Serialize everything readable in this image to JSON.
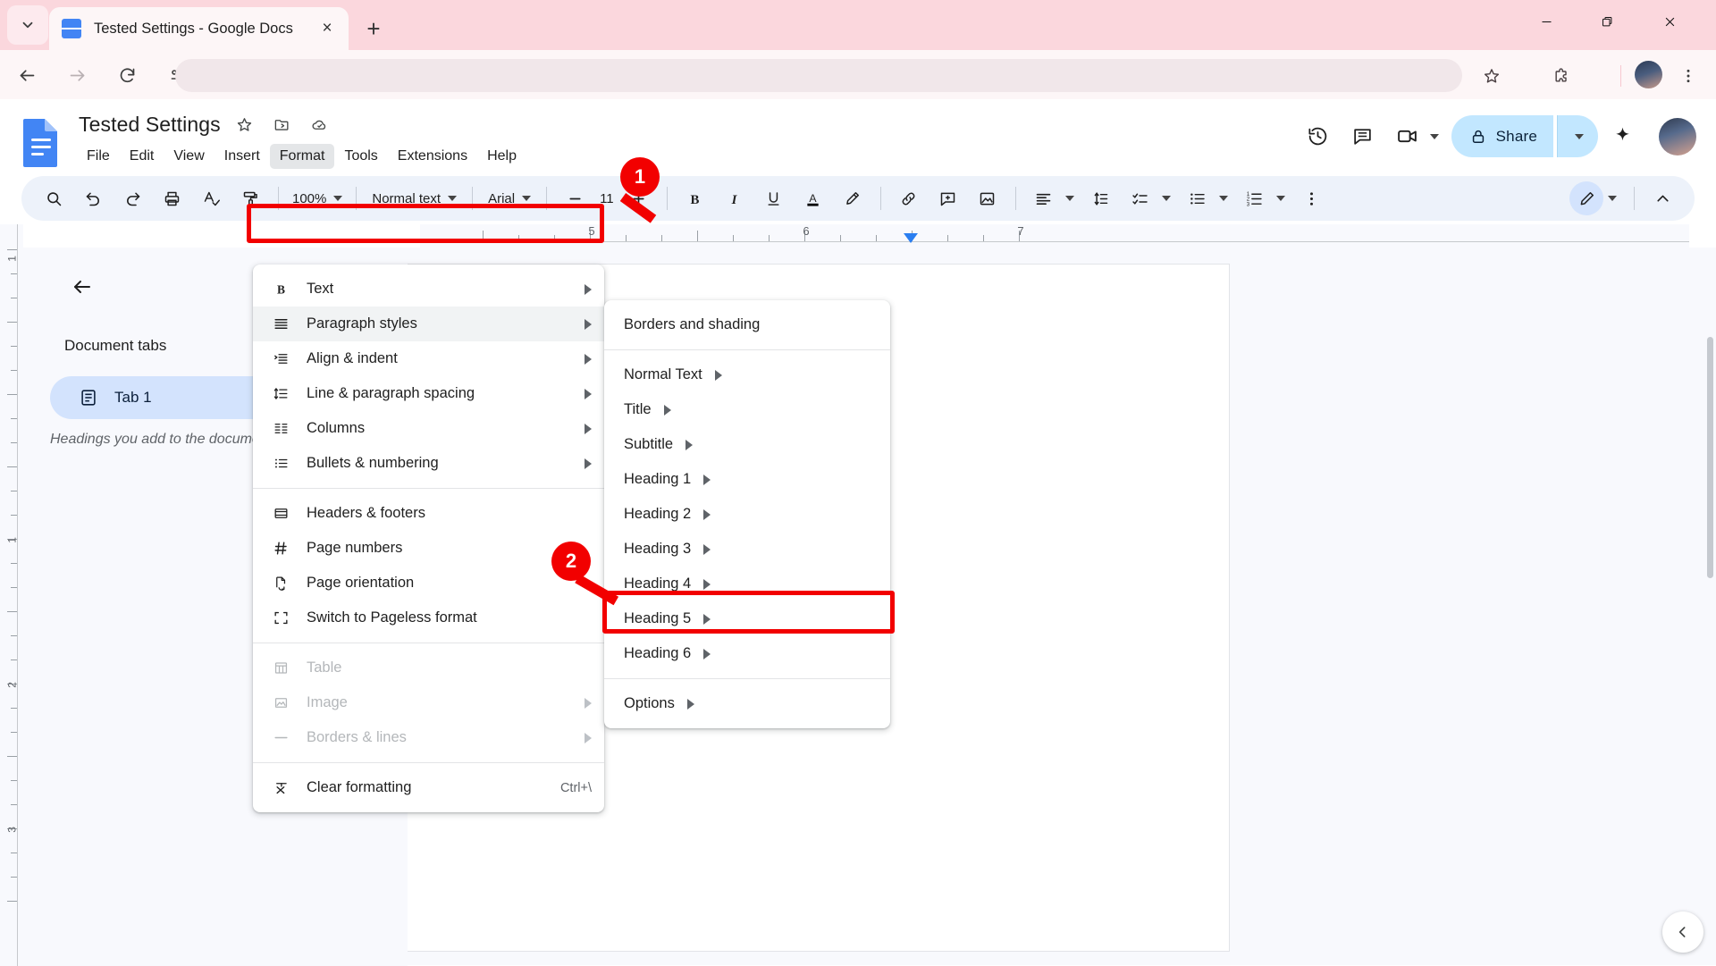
{
  "browser": {
    "tab": {
      "title": "Tested Settings - Google Docs",
      "favicon": "docs-icon",
      "close": "×"
    },
    "new_tab": "+",
    "window_controls": {
      "minimize": "minimize-icon",
      "maximize": "maximize-icon",
      "close": "close-icon"
    },
    "omnibox": {
      "value": "",
      "placeholder": ""
    },
    "toolbar_icons": [
      "back-icon",
      "forward-icon",
      "reload-icon",
      "site-settings-icon",
      "bookmark-star-icon",
      "extensions-icon",
      "profile-avatar",
      "chrome-menu-icon"
    ]
  },
  "docs": {
    "title": "Tested Settings",
    "title_icons": [
      "star-icon",
      "move-to-folder-icon",
      "cloud-saved-icon"
    ],
    "menus": [
      "File",
      "Edit",
      "View",
      "Insert",
      "Format",
      "Tools",
      "Extensions",
      "Help"
    ],
    "active_menu": "Format",
    "header_right": {
      "history_label": "version-history-icon",
      "comments_label": "comments-icon",
      "meet_label": "meet-icon",
      "share_label": "Share",
      "gemini_label": "gemini-spark-icon",
      "avatar_label": "account-avatar"
    },
    "toolbar": {
      "zoom": "100%",
      "style": "Normal text",
      "font": "Arial",
      "font_size": "11",
      "items": [
        "search-icon",
        "undo-icon",
        "redo-icon",
        "print-icon",
        "spellcheck-icon",
        "paint-format-icon",
        "decrease-font-icon",
        "increase-font-icon",
        "bold-icon",
        "italic-icon",
        "underline-icon",
        "text-color-icon",
        "highlight-color-icon",
        "link-icon",
        "comment-icon",
        "image-icon",
        "align-icon",
        "line-spacing-icon",
        "checklist-icon",
        "bulleted-list-icon",
        "numbered-list-icon",
        "more-options-icon",
        "editing-mode-icon",
        "hide-menus-icon"
      ]
    },
    "ruler": {
      "horizontal_numbers": [
        "5",
        "6",
        "7"
      ],
      "vertical_numbers": [
        "1",
        "1",
        "2",
        "3"
      ],
      "indent_marker": "right-indent-marker"
    },
    "outline": {
      "back": "back-arrow-icon",
      "heading": "Document tabs",
      "tab_label": "Tab 1",
      "tab_icon": "document-tab-icon",
      "hint": "Headings you add to the document will appear here."
    },
    "collapse_button": "collapse-panel-icon"
  },
  "format_menu": {
    "items": [
      {
        "label": "Text",
        "icon": "bold-B-icon",
        "arrow": true,
        "disabled": false,
        "highlight": false,
        "shortcut": ""
      },
      {
        "label": "Paragraph styles",
        "icon": "paragraph-styles-icon",
        "arrow": true,
        "disabled": false,
        "highlight": true,
        "shortcut": ""
      },
      {
        "label": "Align & indent",
        "icon": "align-indent-icon",
        "arrow": true,
        "disabled": false,
        "highlight": false,
        "shortcut": ""
      },
      {
        "label": "Line & paragraph spacing",
        "icon": "line-spacing-icon",
        "arrow": true,
        "disabled": false,
        "highlight": false,
        "shortcut": ""
      },
      {
        "label": "Columns",
        "icon": "columns-icon",
        "arrow": true,
        "disabled": false,
        "highlight": false,
        "shortcut": ""
      },
      {
        "label": "Bullets & numbering",
        "icon": "bullets-numbering-icon",
        "arrow": true,
        "disabled": false,
        "highlight": false,
        "shortcut": ""
      },
      {
        "separator": true
      },
      {
        "label": "Headers & footers",
        "icon": "headers-footers-icon",
        "arrow": false,
        "disabled": false,
        "highlight": false,
        "shortcut": ""
      },
      {
        "label": "Page numbers",
        "icon": "page-numbers-icon",
        "arrow": false,
        "disabled": false,
        "highlight": false,
        "shortcut": ""
      },
      {
        "label": "Page orientation",
        "icon": "page-orientation-icon",
        "arrow": false,
        "disabled": false,
        "highlight": false,
        "shortcut": ""
      },
      {
        "label": "Switch to Pageless format",
        "icon": "pageless-icon",
        "arrow": false,
        "disabled": false,
        "highlight": false,
        "shortcut": ""
      },
      {
        "separator": true
      },
      {
        "label": "Table",
        "icon": "table-icon",
        "arrow": false,
        "disabled": true,
        "highlight": false,
        "shortcut": ""
      },
      {
        "label": "Image",
        "icon": "image-icon",
        "arrow": true,
        "disabled": true,
        "highlight": false,
        "shortcut": ""
      },
      {
        "label": "Borders & lines",
        "icon": "borders-lines-icon",
        "arrow": true,
        "disabled": true,
        "highlight": false,
        "shortcut": ""
      },
      {
        "separator": true
      },
      {
        "label": "Clear formatting",
        "icon": "clear-formatting-icon",
        "arrow": false,
        "disabled": false,
        "highlight": false,
        "shortcut": "Ctrl+\\"
      }
    ]
  },
  "paragraph_styles_submenu": {
    "items": [
      {
        "label": "Borders and shading",
        "arrow": false,
        "highlight": false
      },
      {
        "separator": true
      },
      {
        "label": "Normal Text",
        "arrow": true,
        "highlight": false
      },
      {
        "label": "Title",
        "arrow": true,
        "highlight": false
      },
      {
        "label": "Subtitle",
        "arrow": true,
        "highlight": false
      },
      {
        "label": "Heading 1",
        "arrow": true,
        "highlight": false
      },
      {
        "label": "Heading 2",
        "arrow": true,
        "highlight": false
      },
      {
        "label": "Heading 3",
        "arrow": true,
        "highlight": false
      },
      {
        "label": "Heading 4",
        "arrow": true,
        "highlight": false
      },
      {
        "label": "Heading 5",
        "arrow": true,
        "highlight": false
      },
      {
        "label": "Heading 6",
        "arrow": true,
        "highlight": false
      },
      {
        "separator": true
      },
      {
        "label": "Options",
        "arrow": true,
        "highlight": false
      }
    ]
  },
  "annotations": {
    "step1": "1",
    "step2": "2",
    "accent_color": "#f20000"
  }
}
